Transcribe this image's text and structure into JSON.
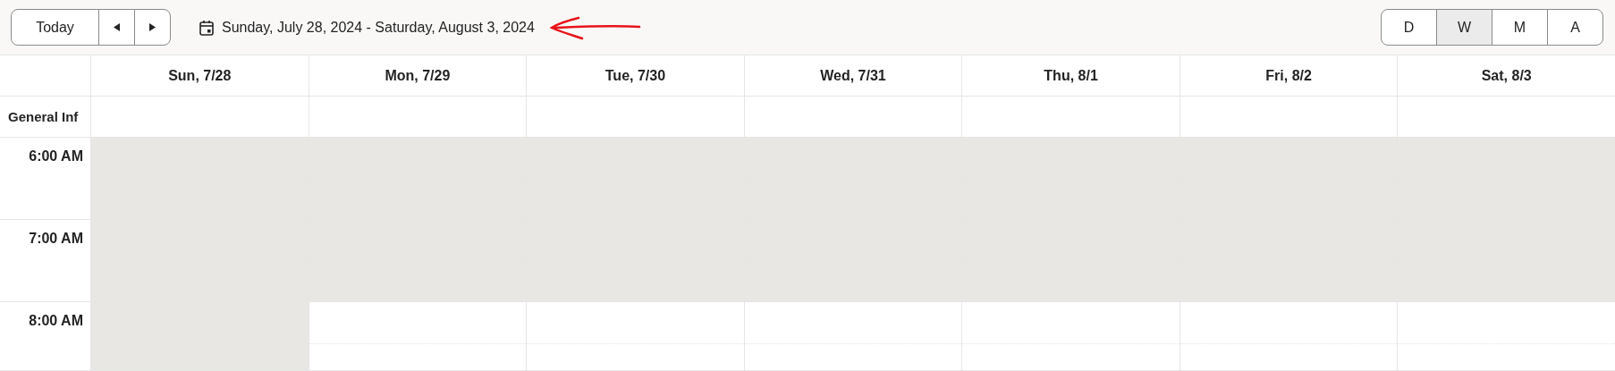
{
  "toolbar": {
    "today_button": "Today",
    "date_range": "Sunday, July 28, 2024 - Saturday, August 3, 2024",
    "views": [
      {
        "label": "D",
        "selected": false
      },
      {
        "label": "W",
        "selected": true
      },
      {
        "label": "M",
        "selected": false
      },
      {
        "label": "A",
        "selected": false
      }
    ]
  },
  "days": [
    "Sun, 7/28",
    "Mon, 7/29",
    "Tue, 7/30",
    "Wed, 7/31",
    "Thu, 8/1",
    "Fri, 8/2",
    "Sat, 8/3"
  ],
  "all_day_row": {
    "label": "General Inf"
  },
  "hours": [
    {
      "time": "6:00 AM",
      "shaded": [
        true,
        true,
        true,
        true,
        true,
        true,
        true
      ]
    },
    {
      "time": "7:00 AM",
      "shaded": [
        true,
        true,
        true,
        true,
        true,
        true,
        true
      ]
    },
    {
      "time": "8:00 AM",
      "shaded": [
        true,
        false,
        false,
        false,
        false,
        false,
        false
      ]
    }
  ]
}
